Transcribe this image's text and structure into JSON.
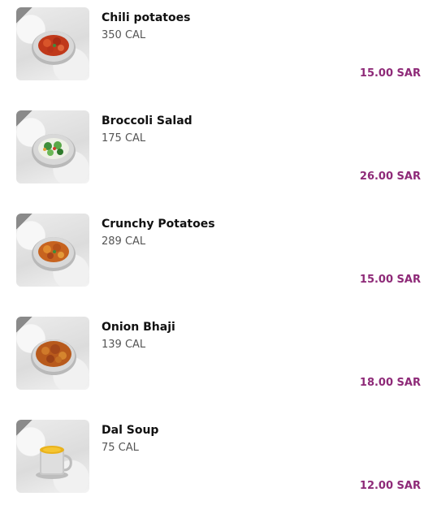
{
  "colors": {
    "price": "#8e2a78",
    "name": "#111111",
    "calories": "#555555"
  },
  "menu": {
    "items": [
      {
        "name": "Chili potatoes",
        "calories": "350 CAL",
        "price": "15.00 SAR",
        "image_icon": "chili-potatoes-dish-image"
      },
      {
        "name": "Broccoli Salad",
        "calories": "175 CAL",
        "price": "26.00 SAR",
        "image_icon": "broccoli-salad-dish-image"
      },
      {
        "name": "Crunchy Potatoes",
        "calories": "289 CAL",
        "price": "15.00 SAR",
        "image_icon": "crunchy-potatoes-dish-image"
      },
      {
        "name": "Onion Bhaji",
        "calories": "139 CAL",
        "price": "18.00 SAR",
        "image_icon": "onion-bhaji-dish-image"
      },
      {
        "name": "Dal Soup",
        "calories": "75 CAL",
        "price": "12.00 SAR",
        "image_icon": "dal-soup-dish-image"
      }
    ]
  }
}
